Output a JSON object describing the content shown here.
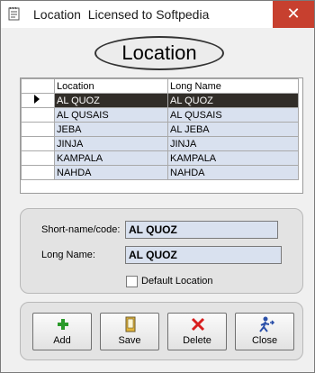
{
  "window": {
    "title": "Location  Licensed to Softpedia",
    "close_glyph": "✕"
  },
  "heading": "Location",
  "grid": {
    "columns": [
      "Location",
      "Long Name"
    ],
    "rows": [
      {
        "location": "AL QUOZ",
        "long_name": "AL QUOZ",
        "current": true
      },
      {
        "location": "AL QUSAIS",
        "long_name": "AL QUSAIS",
        "current": false
      },
      {
        "location": "JEBA",
        "long_name": "AL JEBA",
        "current": false
      },
      {
        "location": "JINJA",
        "long_name": "JINJA",
        "current": false
      },
      {
        "location": "KAMPALA",
        "long_name": "KAMPALA",
        "current": false
      },
      {
        "location": "NAHDA",
        "long_name": "NAHDA",
        "current": false
      }
    ]
  },
  "form": {
    "short_label": "Short-name/code:",
    "short_value": "AL QUOZ",
    "long_label": "Long Name:",
    "long_value": "AL QUOZ",
    "default_label": "Default Location",
    "default_checked": false
  },
  "buttons": {
    "add": "Add",
    "save": "Save",
    "delete": "Delete",
    "close": "Close"
  },
  "colors": {
    "selected_row": "#312d28",
    "field_bg": "#d9e1ef",
    "close_button": "#c7402f"
  }
}
